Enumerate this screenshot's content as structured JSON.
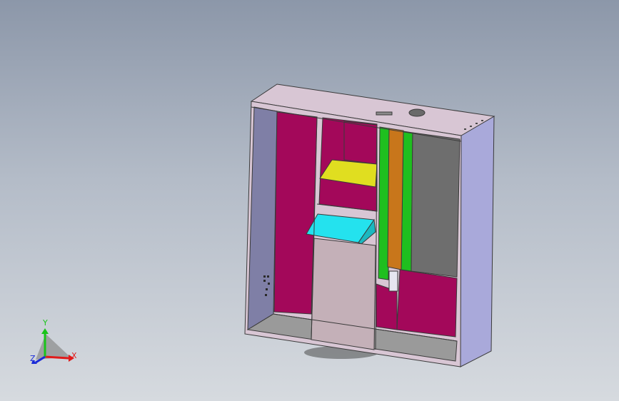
{
  "viewport": {
    "background_top": "#8c97a9",
    "background_bottom": "#d6dadf"
  },
  "model": {
    "colors": {
      "frame": "#d8c6d4",
      "frame_edge": "#3a3a3a",
      "side_panel": "#a9a9da",
      "inner_left_wall": "#7f7fa6",
      "magenta_panel": "#a3085a",
      "yellow_shelf": "#e0de20",
      "cyan_tray": "#24e2ee",
      "green_rail": "#1fbf1f",
      "orange_rail": "#c8761b",
      "gray_panel": "#6e6e6e",
      "door_panel": "#c4b0b8",
      "floor": "#9a9a9a"
    }
  },
  "triad": {
    "x_label": "X",
    "y_label": "Y",
    "z_label": "Z",
    "x_color": "#e01a1a",
    "y_color": "#19c419",
    "z_color": "#1a2ad8"
  }
}
